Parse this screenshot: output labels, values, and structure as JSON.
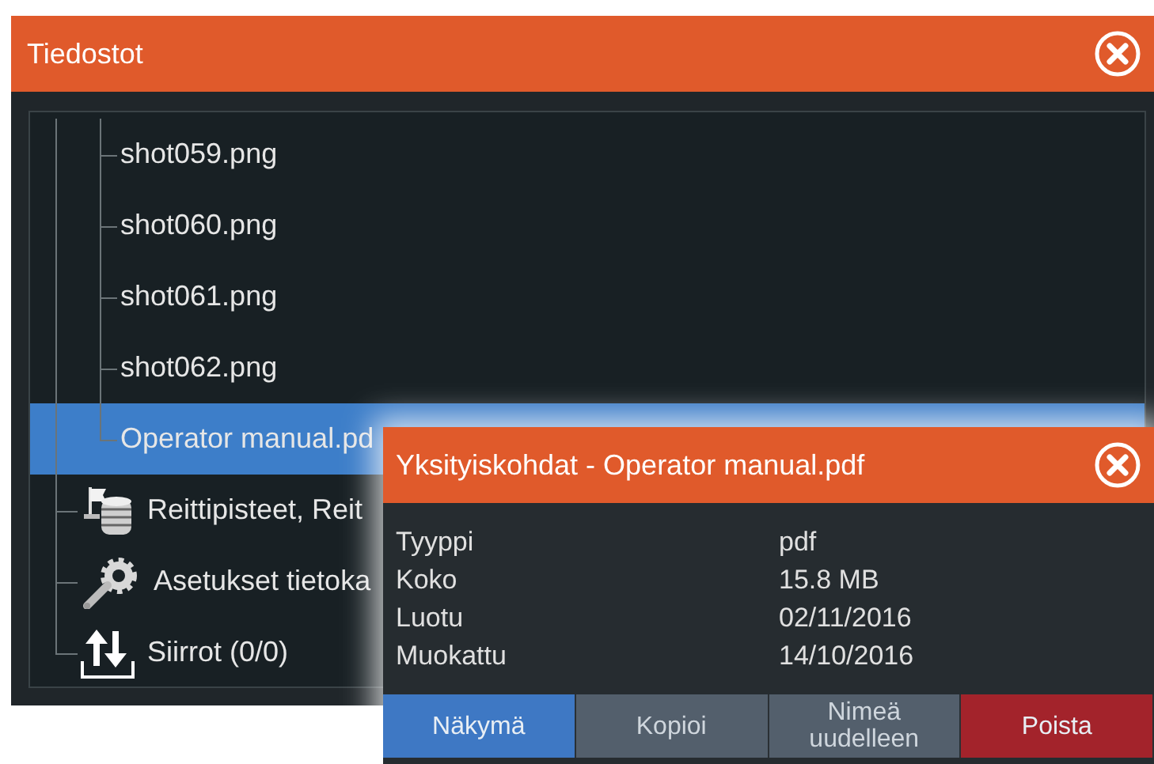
{
  "window": {
    "title": "Tiedostot"
  },
  "tree": [
    {
      "children": [
        {
          "label": "shot059.png",
          "selected": false
        },
        {
          "label": "shot060.png",
          "selected": false
        },
        {
          "label": "shot061.png",
          "selected": false
        },
        {
          "label": "shot062.png",
          "selected": false
        },
        {
          "label": "Operator manual.pd",
          "selected": true
        }
      ]
    },
    {
      "label": "Reittipisteet, Reit",
      "kind": "database",
      "selected": false
    },
    {
      "label": "Asetukset tietoka",
      "kind": "settings",
      "selected": false
    },
    {
      "label": "Siirrot (0/0)",
      "kind": "transfer",
      "selected": false
    }
  ],
  "details_dialog": {
    "title": "Yksityiskohdat - Operator manual.pdf",
    "rows": [
      {
        "label": "Tyyppi",
        "value": "pdf"
      },
      {
        "label": "Koko",
        "value": "15.8 MB"
      },
      {
        "label": "Luotu",
        "value": "02/11/2016"
      },
      {
        "label": "Muokattu",
        "value": "14/10/2016"
      }
    ],
    "buttons": [
      {
        "label": "Näkymä",
        "kind": "primary"
      },
      {
        "label": "Kopioi",
        "kind": "normal"
      },
      {
        "label": "Nimeä uudelleen",
        "kind": "normal"
      },
      {
        "label": "Poista",
        "kind": "danger"
      }
    ]
  }
}
